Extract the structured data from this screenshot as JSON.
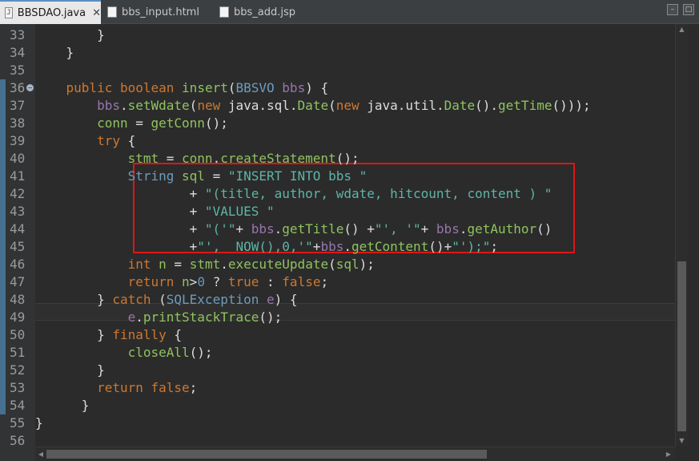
{
  "tabs": [
    {
      "label": "BBSDAO.java",
      "active": true,
      "close": "✕",
      "icon": "java-file-icon"
    },
    {
      "label": "bbs_input.html",
      "active": false,
      "icon": "html-file-icon"
    },
    {
      "label": "bbs_add.jsp",
      "active": false,
      "icon": "jsp-file-icon"
    }
  ],
  "editor": {
    "current_line": "49",
    "line_numbers": [
      "33",
      "34",
      "35",
      "36",
      "37",
      "38",
      "39",
      "40",
      "41",
      "42",
      "43",
      "44",
      "45",
      "46",
      "47",
      "48",
      "49",
      "50",
      "51",
      "52",
      "53",
      "54",
      "55",
      "56"
    ],
    "changed_lines": [
      "36",
      "37",
      "38",
      "39",
      "40",
      "41",
      "42",
      "43",
      "44",
      "45",
      "46",
      "47",
      "48",
      "49",
      "50",
      "51",
      "52",
      "53",
      "54"
    ],
    "code_lines": [
      [
        {
          "t": "        }",
          "c": ""
        }
      ],
      [
        {
          "t": "    }",
          "c": ""
        }
      ],
      [
        {
          "t": "",
          "c": ""
        }
      ],
      [
        {
          "t": "    ",
          "c": ""
        },
        {
          "t": "public",
          "c": "k"
        },
        {
          "t": " ",
          "c": ""
        },
        {
          "t": "boolean",
          "c": "k"
        },
        {
          "t": " ",
          "c": ""
        },
        {
          "t": "insert",
          "c": "m"
        },
        {
          "t": "(",
          "c": ""
        },
        {
          "t": "BBSVO",
          "c": "t"
        },
        {
          "t": " ",
          "c": ""
        },
        {
          "t": "bbs",
          "c": "f"
        },
        {
          "t": ") {",
          "c": ""
        }
      ],
      [
        {
          "t": "        ",
          "c": ""
        },
        {
          "t": "bbs",
          "c": "f"
        },
        {
          "t": ".",
          "c": ""
        },
        {
          "t": "setWdate",
          "c": "m"
        },
        {
          "t": "(",
          "c": ""
        },
        {
          "t": "new",
          "c": "k"
        },
        {
          "t": " java.sql.",
          "c": ""
        },
        {
          "t": "Date",
          "c": "m"
        },
        {
          "t": "(",
          "c": ""
        },
        {
          "t": "new",
          "c": "k"
        },
        {
          "t": " java.util.",
          "c": ""
        },
        {
          "t": "Date",
          "c": "m"
        },
        {
          "t": "().",
          "c": ""
        },
        {
          "t": "getTime",
          "c": "m"
        },
        {
          "t": "()));",
          "c": ""
        }
      ],
      [
        {
          "t": "        ",
          "c": ""
        },
        {
          "t": "conn",
          "c": "m"
        },
        {
          "t": " = ",
          "c": ""
        },
        {
          "t": "getConn",
          "c": "m"
        },
        {
          "t": "();",
          "c": ""
        }
      ],
      [
        {
          "t": "        ",
          "c": ""
        },
        {
          "t": "try",
          "c": "k"
        },
        {
          "t": " {",
          "c": ""
        }
      ],
      [
        {
          "t": "            ",
          "c": ""
        },
        {
          "t": "stmt",
          "c": "m"
        },
        {
          "t": " = ",
          "c": ""
        },
        {
          "t": "conn",
          "c": "m"
        },
        {
          "t": ".",
          "c": ""
        },
        {
          "t": "createStatement",
          "c": "m"
        },
        {
          "t": "();",
          "c": ""
        }
      ],
      [
        {
          "t": "            ",
          "c": ""
        },
        {
          "t": "String",
          "c": "t"
        },
        {
          "t": " ",
          "c": ""
        },
        {
          "t": "sql",
          "c": "m"
        },
        {
          "t": " = ",
          "c": ""
        },
        {
          "t": "\"INSERT INTO bbs \"",
          "c": "s"
        }
      ],
      [
        {
          "t": "                    + ",
          "c": ""
        },
        {
          "t": "\"(title, author, wdate, hitcount, content ) \"",
          "c": "s"
        }
      ],
      [
        {
          "t": "                    + ",
          "c": ""
        },
        {
          "t": "\"VALUES \"",
          "c": "s"
        }
      ],
      [
        {
          "t": "                    + ",
          "c": ""
        },
        {
          "t": "\"('\"",
          "c": "s"
        },
        {
          "t": "+ ",
          "c": ""
        },
        {
          "t": "bbs",
          "c": "f"
        },
        {
          "t": ".",
          "c": ""
        },
        {
          "t": "getTitle",
          "c": "m"
        },
        {
          "t": "() +",
          "c": ""
        },
        {
          "t": "\"', '\"",
          "c": "s"
        },
        {
          "t": "+ ",
          "c": ""
        },
        {
          "t": "bbs",
          "c": "f"
        },
        {
          "t": ".",
          "c": ""
        },
        {
          "t": "getAuthor",
          "c": "m"
        },
        {
          "t": "()",
          "c": ""
        }
      ],
      [
        {
          "t": "                    +",
          "c": ""
        },
        {
          "t": "\"',  NOW(),0,'\"",
          "c": "s"
        },
        {
          "t": "+",
          "c": ""
        },
        {
          "t": "bbs",
          "c": "f"
        },
        {
          "t": ".",
          "c": ""
        },
        {
          "t": "getContent",
          "c": "m"
        },
        {
          "t": "()+",
          "c": ""
        },
        {
          "t": "\"');\"",
          "c": "s"
        },
        {
          "t": ";",
          "c": ""
        }
      ],
      [
        {
          "t": "            ",
          "c": ""
        },
        {
          "t": "int",
          "c": "k"
        },
        {
          "t": " ",
          "c": ""
        },
        {
          "t": "n",
          "c": "m"
        },
        {
          "t": " = ",
          "c": ""
        },
        {
          "t": "stmt",
          "c": "m"
        },
        {
          "t": ".",
          "c": ""
        },
        {
          "t": "executeUpdate",
          "c": "m"
        },
        {
          "t": "(",
          "c": ""
        },
        {
          "t": "sql",
          "c": "m"
        },
        {
          "t": ");",
          "c": ""
        }
      ],
      [
        {
          "t": "            ",
          "c": ""
        },
        {
          "t": "return",
          "c": "k"
        },
        {
          "t": " ",
          "c": ""
        },
        {
          "t": "n",
          "c": "m"
        },
        {
          "t": ">",
          "c": ""
        },
        {
          "t": "0",
          "c": "n"
        },
        {
          "t": " ? ",
          "c": ""
        },
        {
          "t": "true",
          "c": "k"
        },
        {
          "t": " : ",
          "c": ""
        },
        {
          "t": "false",
          "c": "k"
        },
        {
          "t": ";",
          "c": ""
        }
      ],
      [
        {
          "t": "        } ",
          "c": ""
        },
        {
          "t": "catch",
          "c": "k"
        },
        {
          "t": " (",
          "c": ""
        },
        {
          "t": "SQLException",
          "c": "t"
        },
        {
          "t": " ",
          "c": ""
        },
        {
          "t": "e",
          "c": "f"
        },
        {
          "t": ") {",
          "c": ""
        }
      ],
      [
        {
          "t": "            ",
          "c": ""
        },
        {
          "t": "e",
          "c": "f"
        },
        {
          "t": ".",
          "c": ""
        },
        {
          "t": "printStackTrace",
          "c": "m"
        },
        {
          "t": "();",
          "c": ""
        }
      ],
      [
        {
          "t": "        } ",
          "c": ""
        },
        {
          "t": "finally",
          "c": "k"
        },
        {
          "t": " {",
          "c": ""
        }
      ],
      [
        {
          "t": "            ",
          "c": ""
        },
        {
          "t": "closeAll",
          "c": "m"
        },
        {
          "t": "();",
          "c": ""
        }
      ],
      [
        {
          "t": "        }",
          "c": ""
        }
      ],
      [
        {
          "t": "        ",
          "c": ""
        },
        {
          "t": "return",
          "c": "k"
        },
        {
          "t": " ",
          "c": ""
        },
        {
          "t": "false",
          "c": "k"
        },
        {
          "t": ";",
          "c": ""
        }
      ],
      [
        {
          "t": "      }",
          "c": ""
        }
      ],
      [
        {
          "t": "}",
          "c": ""
        }
      ],
      [
        {
          "t": "",
          "c": ""
        }
      ]
    ],
    "highlight_box_lines": [
      "41",
      "45"
    ]
  },
  "colors": {
    "keyword": "#cc7832",
    "string": "#5eb5a6",
    "type": "#6d9cbe",
    "method": "#8fc35f",
    "field": "#9876aa",
    "highlight_border": "#e01515"
  }
}
